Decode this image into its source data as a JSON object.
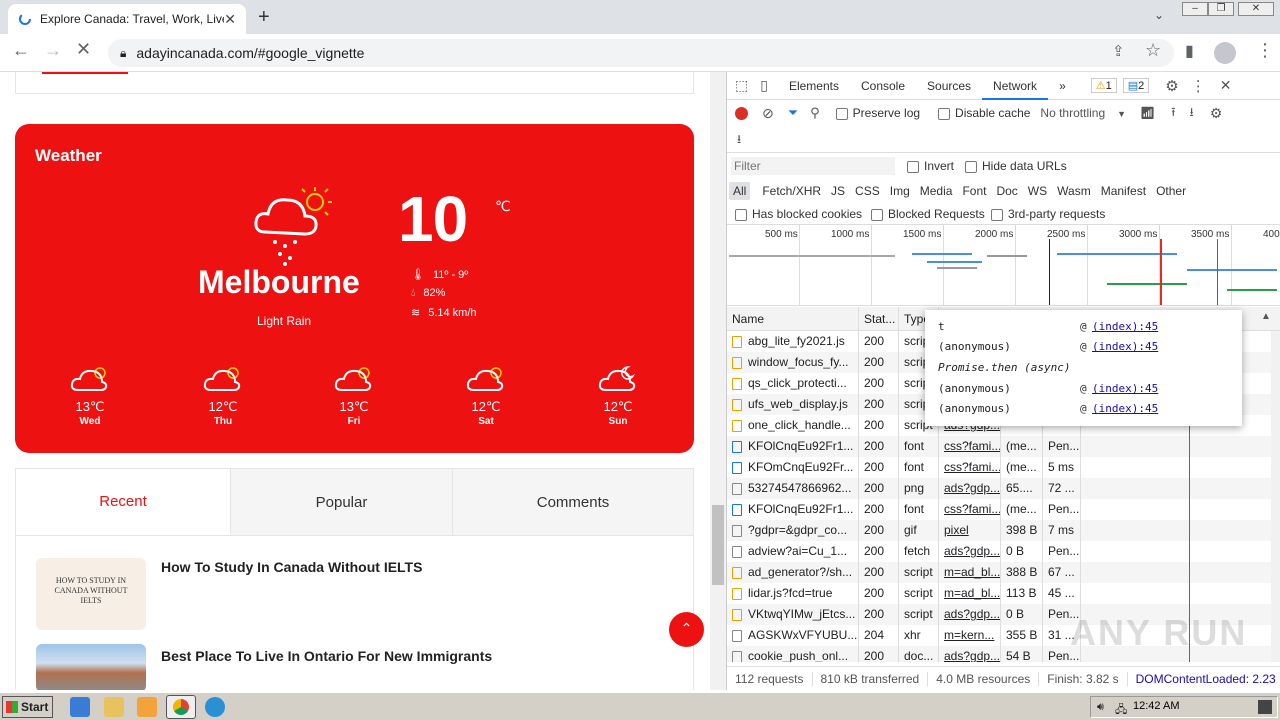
{
  "browser": {
    "tab_title": "Explore Canada: Travel, Work, Live, ",
    "url": "adayincanada.com/#google_vignette"
  },
  "weather": {
    "title": "Weather",
    "temp": "10",
    "unit": "℃",
    "city": "Melbourne",
    "condition": "Light Rain",
    "minmax": "11º - 9º",
    "humidity": "82%",
    "wind": "5.14 km/h",
    "forecast": [
      {
        "temp": "13℃",
        "day": "Wed"
      },
      {
        "temp": "12℃",
        "day": "Thu"
      },
      {
        "temp": "13℃",
        "day": "Fri"
      },
      {
        "temp": "12℃",
        "day": "Sat"
      },
      {
        "temp": "12℃",
        "day": "Sun"
      }
    ]
  },
  "widget_tabs": [
    "Recent",
    "Popular",
    "Comments"
  ],
  "posts": [
    {
      "title": "How To Study In Canada Without IELTS",
      "thumb_text": "HOW TO STUDY IN CANADA WITHOUT IELTS"
    },
    {
      "title": "Best Place To Live In Ontario For New Immigrants"
    }
  ],
  "devtools": {
    "tabs": [
      "Elements",
      "Console",
      "Sources",
      "Network"
    ],
    "more": "»",
    "warn_count": "1",
    "msg_count": "2",
    "toolbar": {
      "preserve_log": "Preserve log",
      "disable_cache": "Disable cache",
      "throttling": "No throttling"
    },
    "filter": {
      "placeholder": "Filter",
      "invert": "Invert",
      "hide_data_urls": "Hide data URLs",
      "types": [
        "All",
        "Fetch/XHR",
        "JS",
        "CSS",
        "Img",
        "Media",
        "Font",
        "Doc",
        "WS",
        "Wasm",
        "Manifest",
        "Other"
      ],
      "blocked_cookies": "Has blocked cookies",
      "blocked_requests": "Blocked Requests",
      "third_party": "3rd-party requests"
    },
    "timeline_ticks": [
      "500 ms",
      "1000 ms",
      "1500 ms",
      "2000 ms",
      "2500 ms",
      "3000 ms",
      "3500 ms",
      "400"
    ],
    "columns": [
      "Name",
      "Stat...",
      "Type"
    ],
    "rows": [
      {
        "name": "abg_lite_fy2021.js",
        "status": "200",
        "type": "scrip",
        "kind": "js",
        "init": "",
        "size": "",
        "time": ""
      },
      {
        "name": "window_focus_fy...",
        "status": "200",
        "type": "scrip",
        "kind": "js",
        "init": "",
        "size": "",
        "time": ""
      },
      {
        "name": "qs_click_protecti...",
        "status": "200",
        "type": "scrip",
        "kind": "js",
        "init": "",
        "size": "",
        "time": ""
      },
      {
        "name": "ufs_web_display.js",
        "status": "200",
        "type": "scrip",
        "kind": "js",
        "init": "",
        "size": "",
        "time": ""
      },
      {
        "name": "one_click_handle...",
        "status": "200",
        "type": "script",
        "kind": "js",
        "init": "ads?gdp...",
        "size": "",
        "time": ""
      },
      {
        "name": "KFOlCnqEu92Fr1...",
        "status": "200",
        "type": "font",
        "kind": "font",
        "init": "css?fami...",
        "size": "(me...",
        "time": "Pen..."
      },
      {
        "name": "KFOmCnqEu92Fr...",
        "status": "200",
        "type": "font",
        "kind": "font",
        "init": "css?fami...",
        "size": "(me...",
        "time": "5 ms"
      },
      {
        "name": "53274547866962...",
        "status": "200",
        "type": "png",
        "kind": "img",
        "init": "ads?gdp...",
        "size": "65....",
        "time": "72 ..."
      },
      {
        "name": "KFOlCnqEu92Fr1...",
        "status": "200",
        "type": "font",
        "kind": "font",
        "init": "css?fami...",
        "size": "(me...",
        "time": "Pen..."
      },
      {
        "name": "?gdpr=&gdpr_co...",
        "status": "200",
        "type": "gif",
        "kind": "img",
        "init": "pixel",
        "size": "398 B",
        "time": "7 ms"
      },
      {
        "name": "adview?ai=Cu_1...",
        "status": "200",
        "type": "fetch",
        "kind": "doc",
        "init": "ads?gdp...",
        "size": "0 B",
        "time": "Pen..."
      },
      {
        "name": "ad_generator?/sh...",
        "status": "200",
        "type": "script",
        "kind": "js",
        "init": "m=ad_bl...",
        "size": "388 B",
        "time": "67 ..."
      },
      {
        "name": "lidar.js?fcd=true",
        "status": "200",
        "type": "script",
        "kind": "js",
        "init": "m=ad_bl...",
        "size": "113 B",
        "time": "45 ..."
      },
      {
        "name": "VKtwqYIMw_jEtcs...",
        "status": "200",
        "type": "script",
        "kind": "js",
        "init": "ads?gdp...",
        "size": "0 B",
        "time": "Pen..."
      },
      {
        "name": "AGSKWxVFYUBU...",
        "status": "204",
        "type": "xhr",
        "kind": "doc",
        "init": "m=kern...",
        "size": "355 B",
        "time": "31 ..."
      },
      {
        "name": "cookie_push_onl...",
        "status": "200",
        "type": "doc...",
        "kind": "img",
        "init": "ads?gdp...",
        "size": "54 B",
        "time": "Pen..."
      }
    ],
    "popup": [
      {
        "fn": "t",
        "at": "@",
        "link": "(index):45"
      },
      {
        "fn": "(anonymous)",
        "at": "@",
        "link": "(index):45"
      },
      {
        "fn": "Promise.then (async)",
        "at": "",
        "link": ""
      },
      {
        "fn": "(anonymous)",
        "at": "@",
        "link": "(index):45"
      },
      {
        "fn": "(anonymous)",
        "at": "@",
        "link": "(index):45"
      }
    ],
    "status": {
      "requests": "112 requests",
      "transferred": "810 kB transferred",
      "resources": "4.0 MB resources",
      "finish": "Finish: 3.82 s",
      "dcl": "DOMContentLoaded: 2.23"
    }
  },
  "taskbar": {
    "start": "Start",
    "clock": "12:42 AM"
  },
  "watermark": "ANY RUN"
}
